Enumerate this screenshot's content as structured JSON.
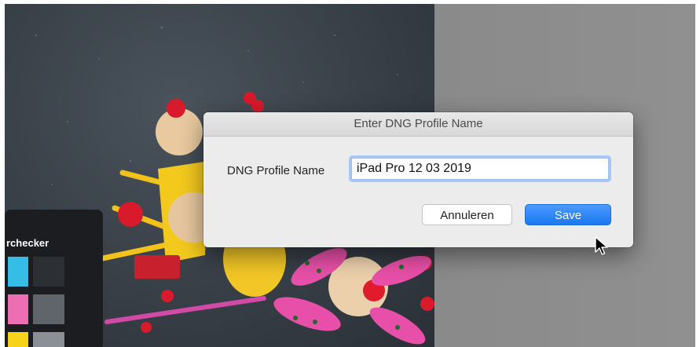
{
  "dialog": {
    "title": "Enter DNG Profile Name",
    "field_label": "DNG Profile Name",
    "field_value": "iPad Pro 12 03 2019",
    "cancel_label": "Annuleren",
    "save_label": "Save"
  },
  "photo": {
    "colorchecker_label": "rchecker"
  },
  "colors": {
    "accent": "#1877f2",
    "dialog_bg": "#ececec",
    "gray_background": "#8c8c8c"
  }
}
